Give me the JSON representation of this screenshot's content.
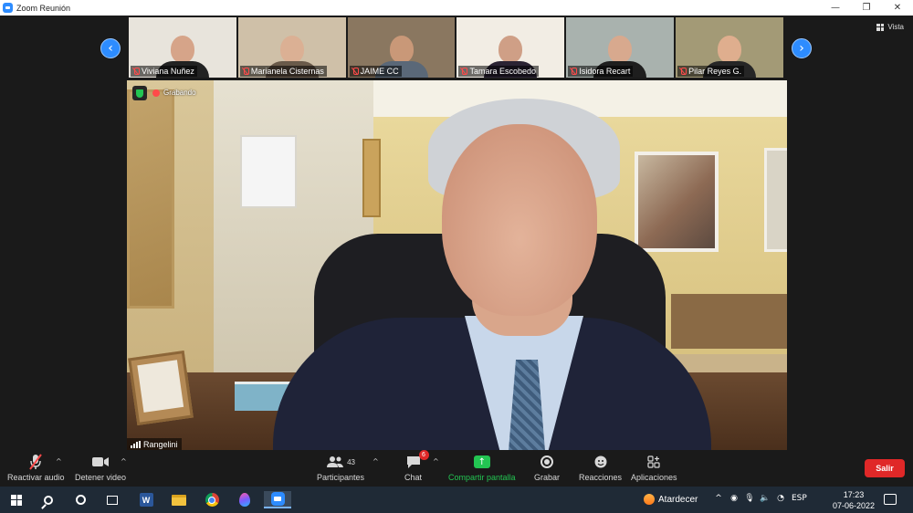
{
  "window": {
    "title": "Zoom Reunión",
    "controls": [
      "—",
      "❐",
      "✕"
    ]
  },
  "view_button": {
    "label": "Vista",
    "icon": "grid-icon"
  },
  "gallery": {
    "participants": [
      {
        "name": "Viviana Nuñez",
        "bg": "#e8e4dc",
        "skin": "#d6a489",
        "clothes": "#222222"
      },
      {
        "name": "Marianela Cisternas",
        "bg": "#cfc0a8",
        "skin": "#dbb094",
        "clothes": "#6a5a4a"
      },
      {
        "name": "JAIME CC",
        "bg": "#8a7760",
        "skin": "#c99878",
        "clothes": "#5a6878"
      },
      {
        "name": "Tamara Escobedo",
        "bg": "#f2ede4",
        "skin": "#cf9f86",
        "clothes": "#2b2333"
      },
      {
        "name": "Isidora Recart",
        "bg": "#a9b2ae",
        "skin": "#d8a98e",
        "clothes": "#1e1e1e"
      },
      {
        "name": "Pilar Reyes G.",
        "bg": "#a39a76",
        "skin": "#dfae8e",
        "clothes": "#262626"
      }
    ]
  },
  "main_video": {
    "recording_label": "Grabando",
    "speaker_name": "Rangelini"
  },
  "toolbar": {
    "audio_label": "Reactivar audio",
    "video_label": "Detener video",
    "participants_label": "Participantes",
    "participants_count": "43",
    "chat_label": "Chat",
    "chat_badge": "6",
    "share_label": "Compartir pantalla",
    "record_label": "Grabar",
    "reactions_label": "Reacciones",
    "apps_label": "Aplicaciones",
    "leave_label": "Salir"
  },
  "taskbar": {
    "weather_label": "Atardecer",
    "language": "ESP",
    "time": "17:23",
    "date": "07-06-2022"
  },
  "colors": {
    "zoom_blue": "#2d8cff",
    "share_green": "#23c552",
    "leave_red": "#e02828",
    "mute_red": "#ff4a4a"
  }
}
